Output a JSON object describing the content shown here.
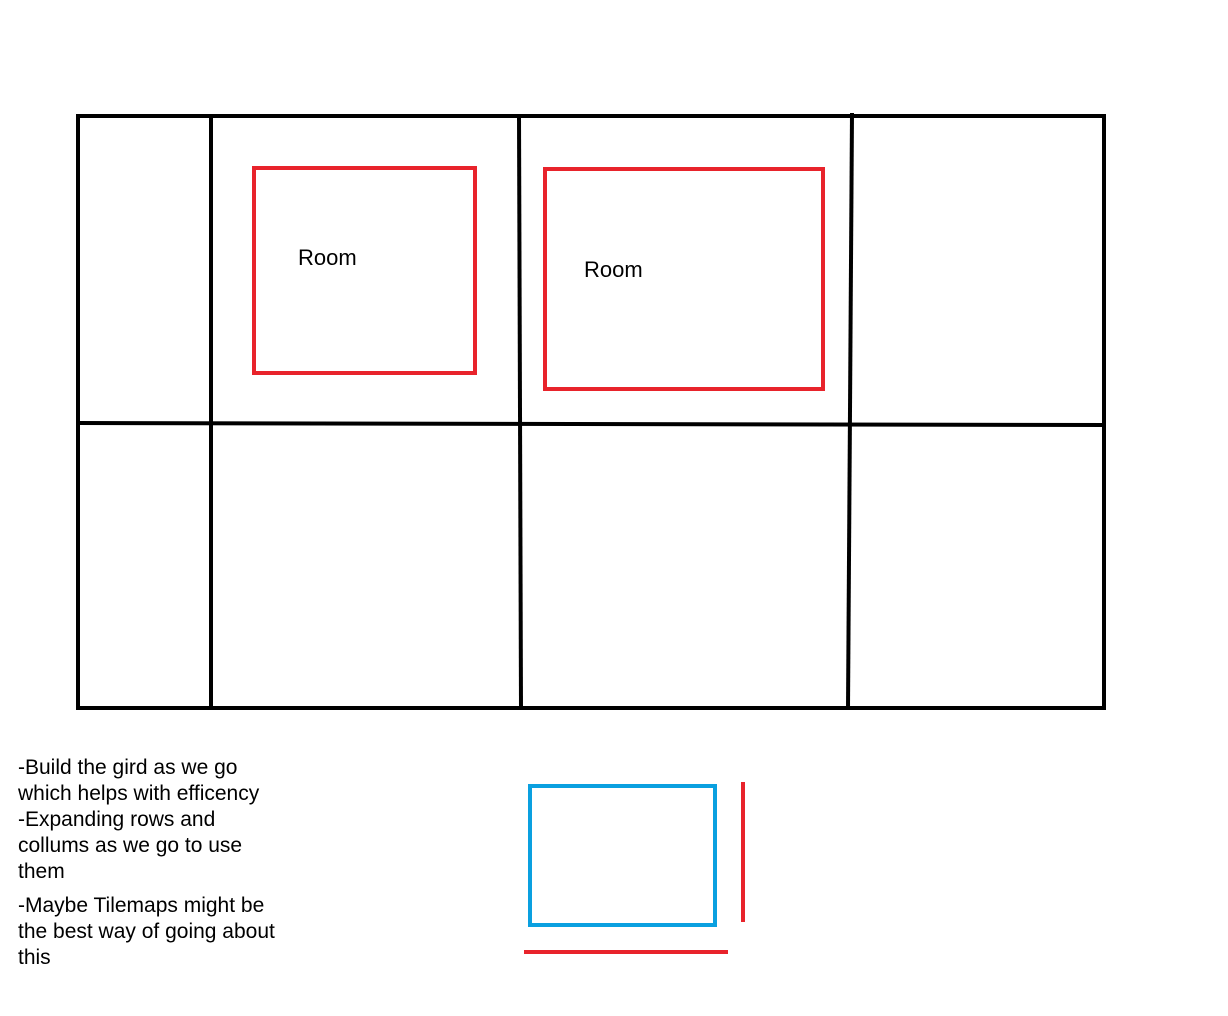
{
  "diagram": {
    "rooms": [
      {
        "label": "Room"
      },
      {
        "label": "Room"
      }
    ],
    "notes": [
      "-Build the gird as we go\nwhich helps with efficency",
      "-Expanding rows and\ncollums as we go to use\nthem",
      "-Maybe Tilemaps might be\nthe best way of going about\nthis"
    ]
  },
  "colors": {
    "grid_line": "#000000",
    "room_outline": "#e8232b",
    "tile_outline": "#0aa0e0",
    "size_marker": "#e8232b",
    "background": "#ffffff"
  }
}
